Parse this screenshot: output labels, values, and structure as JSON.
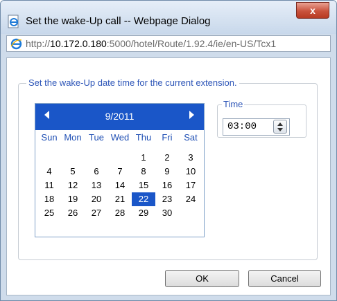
{
  "window": {
    "title": "Set the wake-Up call -- Webpage Dialog",
    "close_label": "x",
    "address": {
      "scheme": "http://",
      "host": "10.172.0.180",
      "path": ":5000/hotel/Route/1.92.4/ie/en-US/Tcx1"
    }
  },
  "form": {
    "legend": "Set the wake-Up date time for the current extension.",
    "calendar": {
      "month_label": "9/2011",
      "weekdays": [
        "Sun",
        "Mon",
        "Tue",
        "Wed",
        "Thu",
        "Fri",
        "Sat"
      ],
      "days": [
        [
          "",
          "",
          "",
          "",
          "1",
          "2",
          "3"
        ],
        [
          "4",
          "5",
          "6",
          "7",
          "8",
          "9",
          "10"
        ],
        [
          "11",
          "12",
          "13",
          "14",
          "15",
          "16",
          "17"
        ],
        [
          "18",
          "19",
          "20",
          "21",
          "22",
          "23",
          "24"
        ],
        [
          "25",
          "26",
          "27",
          "28",
          "29",
          "30",
          ""
        ]
      ],
      "selected_day": "22"
    },
    "time": {
      "legend": "Time",
      "value": "03:00"
    }
  },
  "buttons": {
    "ok": "OK",
    "cancel": "Cancel"
  },
  "colors": {
    "calendar_header": "#1a56c8",
    "legend_text": "#2e56b8",
    "selected_day": "#1a56c8"
  },
  "icons": {
    "title": "ie-page-icon",
    "address": "ie-logo-icon",
    "prev": "triangle-left-icon",
    "next": "triangle-right-icon",
    "spinner": "spin-updown-icon"
  }
}
